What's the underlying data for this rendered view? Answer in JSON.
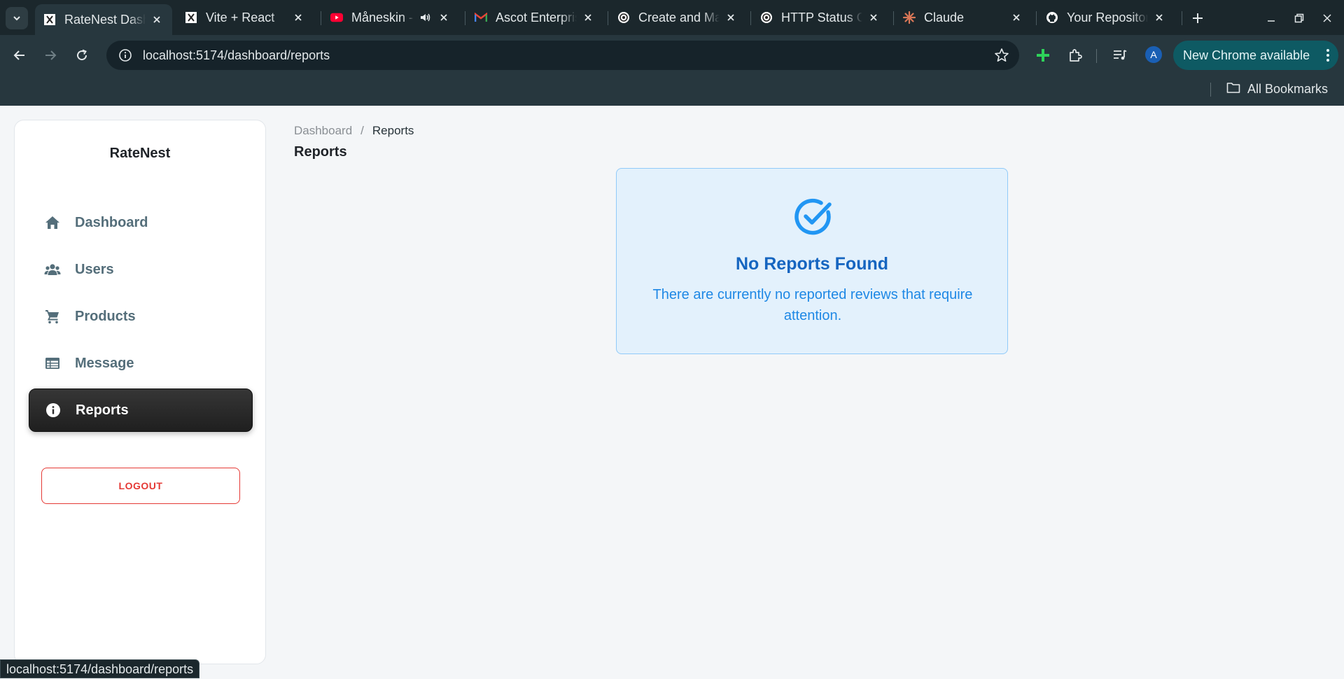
{
  "browser": {
    "tabs": [
      {
        "title": "RateNest Dashboard",
        "favicon": "ratenest-icon",
        "active": true
      },
      {
        "title": "Vite + React",
        "favicon": "ratenest-icon"
      },
      {
        "title": "Måneskin - ",
        "favicon": "youtube-icon",
        "audio": true
      },
      {
        "title": "Ascot Enterprises",
        "favicon": "gmail-icon"
      },
      {
        "title": "Create and Manage",
        "favicon": "openai-icon"
      },
      {
        "title": "HTTP Status Codes",
        "favicon": "openai-icon"
      },
      {
        "title": "Claude",
        "favicon": "claude-icon"
      },
      {
        "title": "Your Repositories",
        "favicon": "github-icon"
      }
    ],
    "url": "localhost:5174/dashboard/reports",
    "profile_initial": "A",
    "update_label": "New Chrome available",
    "bookmarks_label": "All Bookmarks",
    "status_url": "localhost:5174/dashboard/reports",
    "colors": {
      "frame": "#1b272c",
      "toolbar": "#27373e",
      "update_pill": "#0e5a63"
    }
  },
  "sidebar": {
    "brand": "RateNest",
    "items": [
      {
        "label": "Dashboard",
        "icon": "home-icon"
      },
      {
        "label": "Users",
        "icon": "users-icon"
      },
      {
        "label": "Products",
        "icon": "cart-icon"
      },
      {
        "label": "Message",
        "icon": "table-icon"
      },
      {
        "label": "Reports",
        "icon": "info-icon",
        "active": true
      }
    ],
    "logout_label": "LOGOUT"
  },
  "main": {
    "breadcrumb": {
      "parent": "Dashboard",
      "separator": "/",
      "current": "Reports"
    },
    "title": "Reports",
    "empty_state": {
      "icon": "check-circle-icon",
      "heading": "No Reports Found",
      "description": "There are currently no reported reviews that require attention."
    }
  },
  "colors": {
    "accent_blue": "#1565c0",
    "card_bg": "#e3f1fc",
    "active_nav": "#2a2a2a",
    "logout_red": "#e53935"
  }
}
